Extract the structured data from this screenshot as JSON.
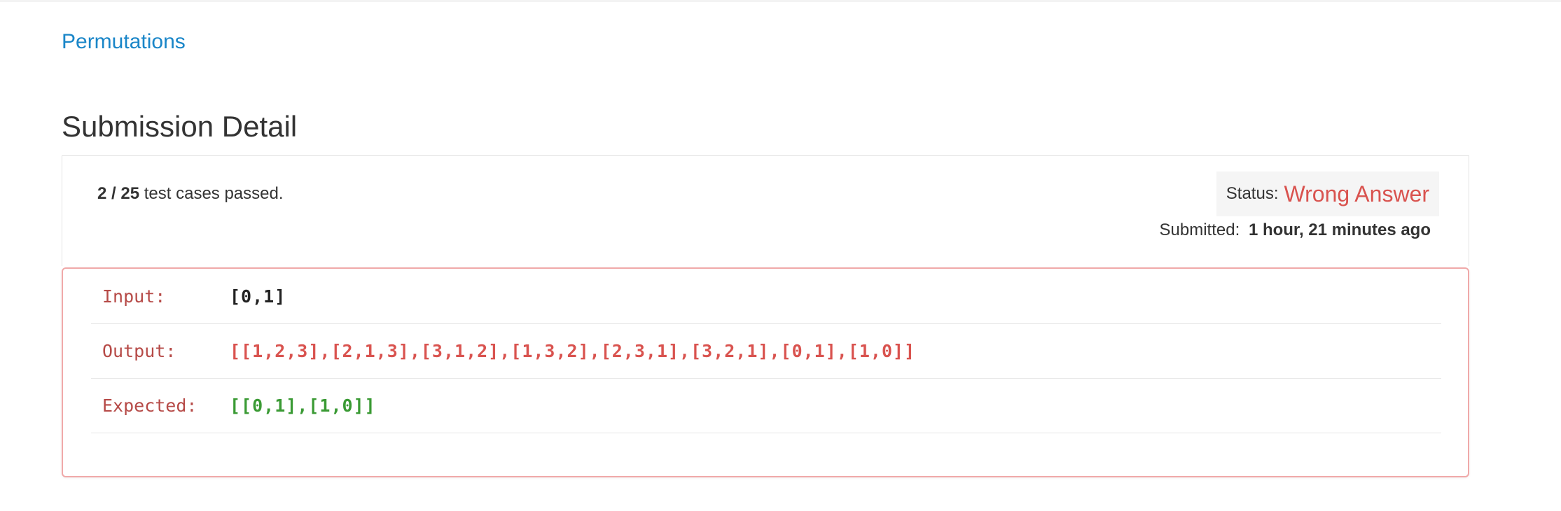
{
  "problem": {
    "link_text": "Permutations"
  },
  "page_title": "Submission Detail",
  "summary": {
    "passed": "2",
    "separator": " / ",
    "total": "25",
    "suffix": " test cases passed.",
    "status_label": "Status:",
    "status_value": "Wrong Answer",
    "submitted_label": "Submitted:",
    "submitted_value": "1 hour, 21 minutes ago"
  },
  "result": {
    "rows": [
      {
        "label": "Input:",
        "value": "[0,1]"
      },
      {
        "label": "Output:",
        "value": "[[1,2,3],[2,1,3],[3,1,2],[1,3,2],[2,3,1],[3,2,1],[0,1],[1,0]]"
      },
      {
        "label": "Expected:",
        "value": "[[0,1],[1,0]]"
      }
    ]
  },
  "colors": {
    "link": "#1a86c8",
    "status_wrong": "#d9534f",
    "output": "#d9534f",
    "expected": "#3a9a34",
    "label": "#b64a47",
    "panel_border_error": "#f0a9a9"
  }
}
